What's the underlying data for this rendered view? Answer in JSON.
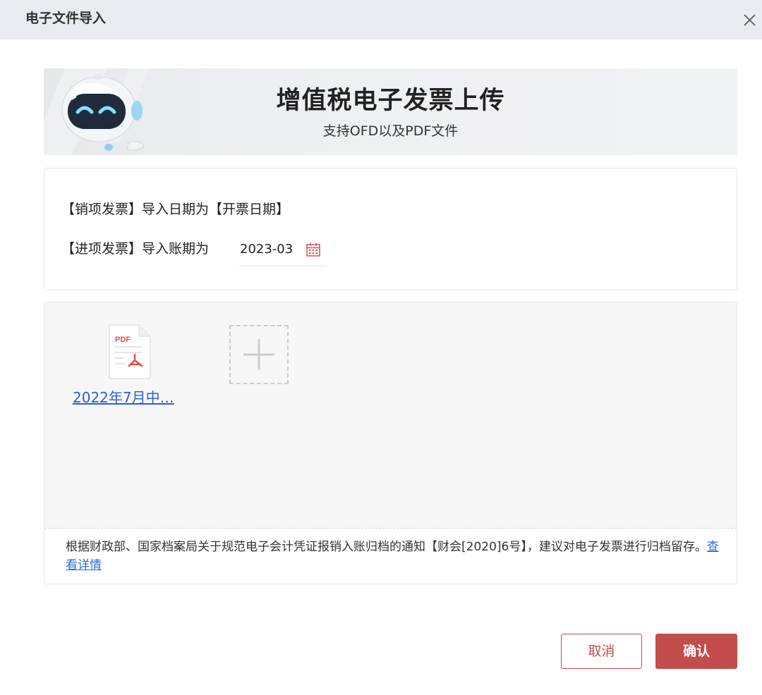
{
  "dialog": {
    "title": "电子文件导入",
    "close_icon": "close-icon"
  },
  "banner": {
    "title": "增值税电子发票上传",
    "subtitle": "支持OFD以及PDF文件",
    "mascot": "robot-mascot-image"
  },
  "settings": {
    "sales_label": "【销项发票】导入日期为【开票日期】",
    "purchase_label": "【进项发票】导入账期为",
    "period_value": "2023-03",
    "calendar_icon": "calendar-icon"
  },
  "upload": {
    "files": [
      {
        "name": "2022年7月中…",
        "icon": "pdf-file-icon",
        "icon_text": "PDF"
      }
    ],
    "add_icon": "plus-icon",
    "notice_text": "根据财政部、国家档案局关于规范电子会计凭证报销入账归档的通知【财会[2020]6号】，建议对电子发票进行归档留存。",
    "notice_link": "查看详情"
  },
  "footer": {
    "cancel_label": "取消",
    "confirm_label": "确认"
  },
  "colors": {
    "accent": "#c34c4c",
    "link": "#2b5fd9",
    "titlebar": "#e9ebf0"
  }
}
